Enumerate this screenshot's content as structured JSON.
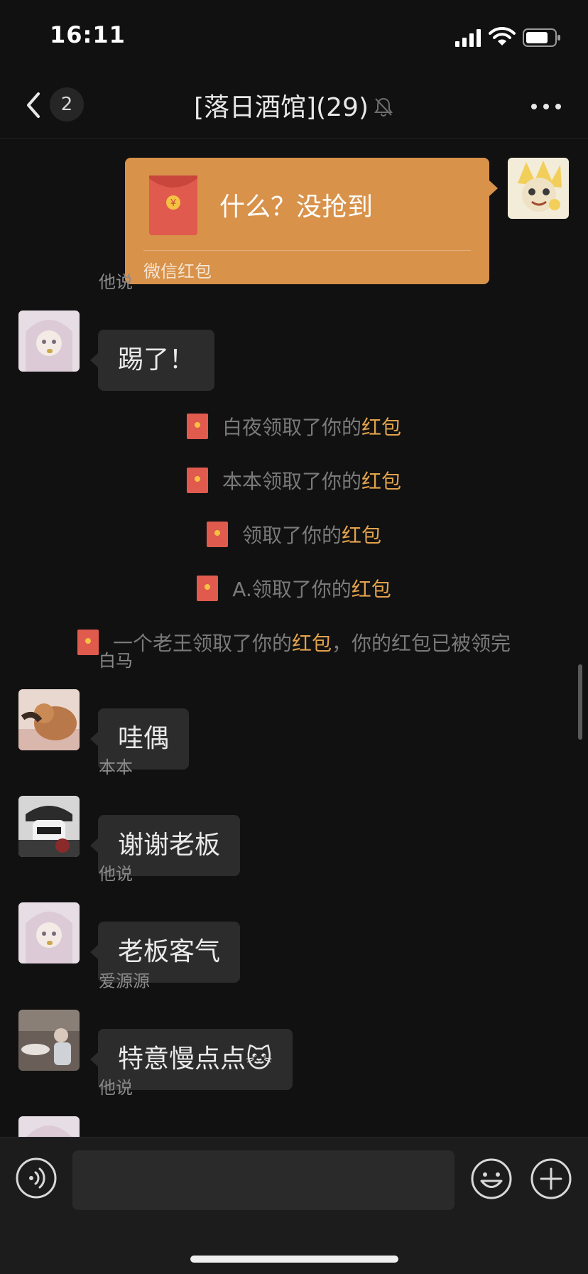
{
  "status_bar": {
    "time": "16:11"
  },
  "nav": {
    "unread_count": "2",
    "title": "[落日酒馆](29)"
  },
  "red_packet": {
    "title": "什么？没抢到",
    "footer": "微信红包"
  },
  "messages": [
    {
      "sender": "他说",
      "text": "踢了！"
    },
    {
      "sender": "白马",
      "text": "哇偶"
    },
    {
      "sender": "本本",
      "text": "谢谢老板"
    },
    {
      "sender": "他说",
      "text": "老板客气"
    },
    {
      "sender": "爱源源",
      "text": "特意慢点点",
      "emoji": "🐱"
    },
    {
      "sender": "他说"
    }
  ],
  "notices": [
    {
      "prefix": "白夜领取了你的",
      "highlight": "红包",
      "suffix": ""
    },
    {
      "prefix": "本本领取了你的",
      "highlight": "红包",
      "suffix": ""
    },
    {
      "prefix": "领取了你的",
      "highlight": "红包",
      "suffix": ""
    },
    {
      "prefix": "A.领取了你的",
      "highlight": "红包",
      "suffix": ""
    },
    {
      "prefix": "一个老王领取了你的",
      "highlight": "红包",
      "suffix": "，你的红包已被领完"
    }
  ],
  "input": {
    "placeholder": ""
  },
  "colors": {
    "background": "#111111",
    "bubble": "#2c2c2c",
    "red_packet_card": "#d8924a",
    "envelope_red": "#e05a4e",
    "highlight_text": "#e2a24d"
  },
  "icons": [
    "back-icon",
    "bell-muted-icon",
    "more-icon",
    "red-envelope-icon",
    "voice-icon",
    "emoji-icon",
    "plus-icon",
    "signal-icon",
    "wifi-icon",
    "battery-icon"
  ]
}
